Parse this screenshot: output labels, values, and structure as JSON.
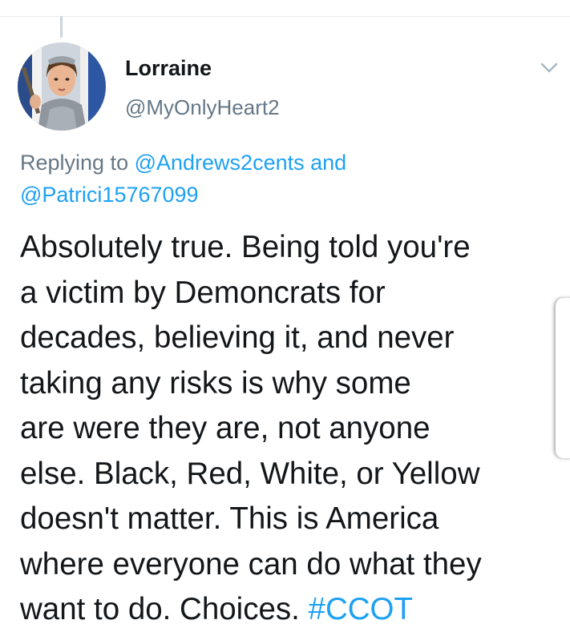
{
  "user": {
    "display_name": "Lorraine",
    "handle": "@MyOnlyHeart2"
  },
  "reply": {
    "prefix": "Replying to ",
    "mention_1": "@Andrews2cents",
    "conjunction": " and",
    "mention_2": "@Patrici15767099"
  },
  "tweet": {
    "lines": [
      "Absolutely true. Being told you're",
      "a victim by Demoncrats for",
      "decades, believing it, and never",
      "taking any risks is why some",
      "are were they are, not anyone",
      "else. Black, Red, White, or Yellow",
      "doesn't matter. This is America",
      "where everyone can do what they",
      "want to do. Choices. "
    ],
    "hashtag": "#CCOT"
  },
  "icons": {
    "avatar": "profile-avatar",
    "menu": "chevron-down-icon"
  },
  "colors": {
    "link": "#1da1f2",
    "secondary_text": "#657786",
    "primary_text": "#14171a",
    "divider": "#e6ecf0"
  }
}
